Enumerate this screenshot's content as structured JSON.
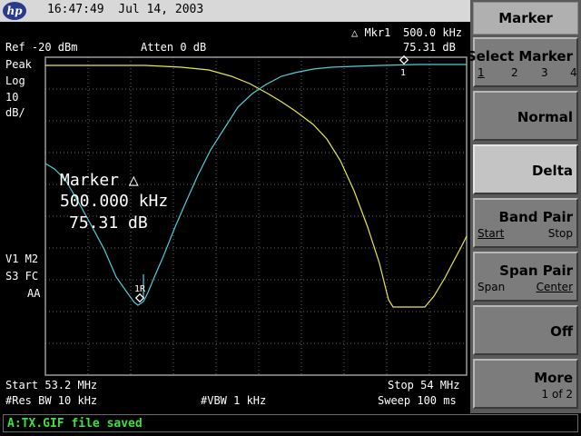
{
  "header": {
    "logo_text": "hp",
    "datetime": "16:47:49  Jul 14, 2003"
  },
  "screen": {
    "ref_level": "Ref -20 dBm",
    "atten": "Atten 0 dB",
    "marker_readout_label": "△ Mkr1",
    "marker_readout_freq": "500.0 kHz",
    "marker_readout_value": "75.31 dB",
    "left_annot": [
      "Peak",
      "Log",
      "10",
      "dB/"
    ],
    "left_annot2": [
      "V1 M2",
      "S3 FC",
      "AA"
    ],
    "marker_box_title": "Marker △",
    "marker_box_freq": "500.000 kHz",
    "marker_box_value": "75.31 dB",
    "marker1_tag": "1",
    "marker1r_tag": "1R",
    "start": "Start 53.2 MHz",
    "stop": "Stop 54 MHz",
    "res_bw": "#Res BW 10 kHz",
    "vbw": "#VBW 1 kHz",
    "sweep": "Sweep 100 ms",
    "colors": {
      "trace1": "#e8e84a",
      "trace2": "#4ad0d8",
      "grid": "#6a6a6a"
    }
  },
  "softkeys": {
    "title": "Marker",
    "select_marker": {
      "label": "Select Marker",
      "options": [
        "1",
        "2",
        "3",
        "4"
      ],
      "selected": "1"
    },
    "normal": "Normal",
    "delta": "Delta",
    "band_pair": {
      "label": "Band Pair",
      "left": "Start",
      "right": "Stop"
    },
    "span_pair": {
      "label": "Span Pair",
      "left": "Span",
      "right": "Center"
    },
    "off": "Off",
    "more": {
      "label": "More",
      "sub": "1 of 2"
    }
  },
  "status": {
    "message": "A:TX.GIF file saved"
  }
}
